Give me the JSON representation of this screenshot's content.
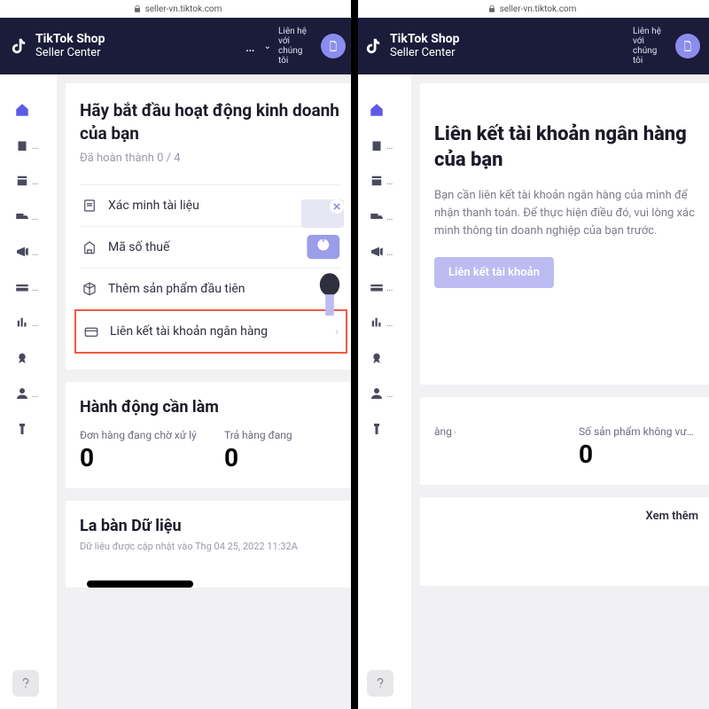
{
  "url": "seller-vn.tiktok.com",
  "brand_top": "TikTok Shop",
  "brand_bot": "Seller Center",
  "contact": "Liên hệ với chúng tôi",
  "left": {
    "title": "Hãy bắt đầu hoạt động kinh doanh của bạn",
    "progress": "Đã hoàn thành 0 / 4",
    "steps": {
      "verify": "Xác minh tài liệu",
      "tax": "Mã số thuế",
      "product": "Thêm sản phẩm đầu tiên",
      "bank": "Liên kết tài khoản ngân hàng"
    },
    "actions_title": "Hành động cần làm",
    "stat1_label": "Đơn hàng đang chờ xử lý",
    "stat1_val": "0",
    "stat2_label": "Trả hàng đang",
    "stat2_val": "0",
    "compass_title": "La bàn Dữ liệu",
    "compass_sub": "Dữ liệu được cập nhật vào Thg 04 25, 2022 11:32A"
  },
  "right": {
    "title": "Liên kết tài khoản ngân hàng của bạn",
    "desc": "Bạn cần liên kết tài khoản ngân hàng của mình để nhận thanh toán. Để thực hiện điều đó, vui lòng xác minh thông tin doanh nghiệp của bạn trước.",
    "cta": "Liên kết tài khoản",
    "stat1_label": "àng",
    "stat1_val": "",
    "stat2_label": "Số sản phẩm không vư…",
    "stat2_val": "0",
    "see_more": "Xem thêm"
  }
}
